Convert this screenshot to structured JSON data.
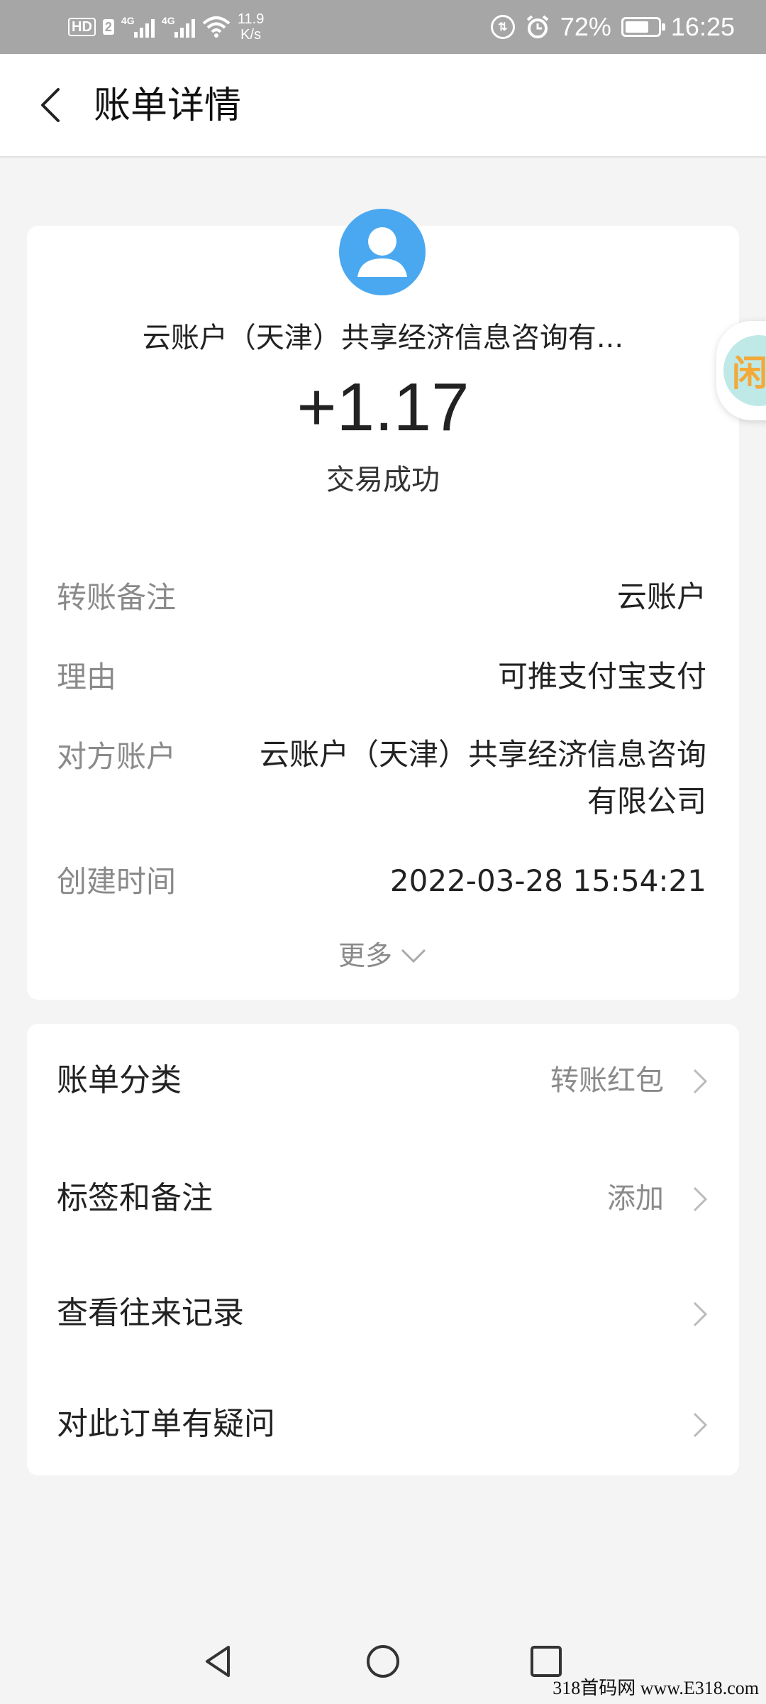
{
  "status_bar": {
    "hd": "HD",
    "sim": "2",
    "network_1": "4G",
    "network_2": "4G",
    "speed_value": "11.9",
    "speed_unit": "K/s",
    "battery": "72%",
    "battery_level": 0.72,
    "time": "16:25"
  },
  "header": {
    "title": "账单详情",
    "back_icon": "chevron-left-icon"
  },
  "transaction": {
    "payee": "云账户（天津）共享经济信息咨询有...",
    "amount": "+1.17",
    "status": "交易成功",
    "avatar_icon": "user-avatar-icon",
    "avatar_color": "#4aa8f0"
  },
  "details": [
    {
      "label": "转账备注",
      "value": "云账户"
    },
    {
      "label": "理由",
      "value": "可推支付宝支付"
    },
    {
      "label": "对方账户",
      "value_line1": "云账户（天津）共享经济信息咨询",
      "value_line2": "有限公司"
    },
    {
      "label": "创建时间",
      "value": "2022-03-28 15:54:21"
    }
  ],
  "more": {
    "label": "更多",
    "icon": "chevron-down-icon"
  },
  "menu": [
    {
      "label": "账单分类",
      "value": "转账红包"
    },
    {
      "label": "标签和备注",
      "value": "添加"
    },
    {
      "label": "查看往来记录",
      "value": ""
    },
    {
      "label": "对此订单有疑问",
      "value": ""
    }
  ],
  "floating_badge": {
    "text": "闲"
  },
  "watermark": "318首码网 www.E318.com"
}
